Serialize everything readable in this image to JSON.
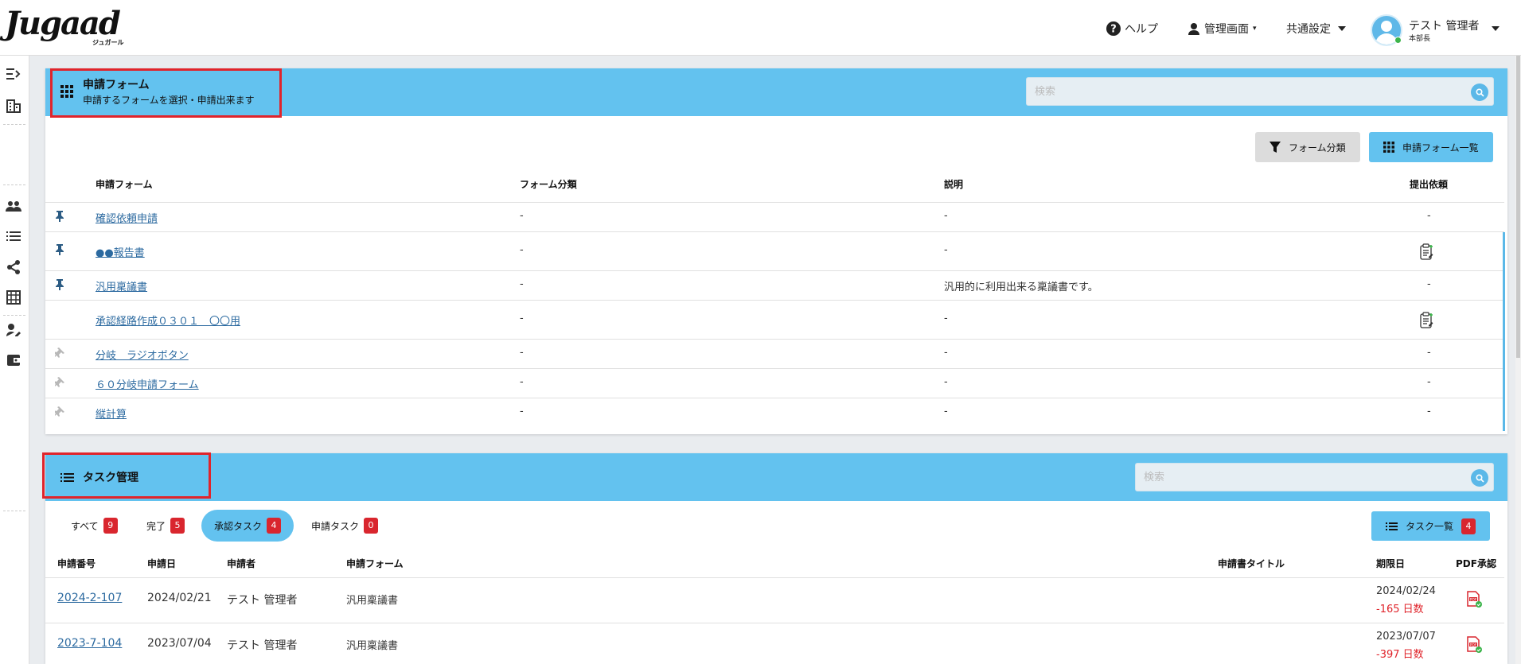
{
  "header": {
    "logo_text": "Jugaad",
    "logo_sub": "ジュガール",
    "help_label": "ヘルプ",
    "admin_label": "管理画面",
    "common_settings_label": "共通設定",
    "user_name": "テスト 管理者",
    "user_role": "本部長"
  },
  "sidebar": {
    "icons": [
      "collapse-icon",
      "building-icon",
      "users-icon",
      "list-icon",
      "share-icon",
      "table-icon",
      "person-edit-icon",
      "wallet-icon"
    ]
  },
  "form_panel": {
    "title": "申請フォーム",
    "subtitle": "申請するフォームを選択・申請出来ます",
    "search_placeholder": "検索",
    "filter_button": "フォーム分類",
    "list_button": "申請フォーム一覧",
    "columns": [
      "申請フォーム",
      "フォーム分類",
      "説明",
      "提出依頼"
    ],
    "rows": [
      {
        "pinned": true,
        "name": "確認依頼申請",
        "category": "-",
        "description": "-",
        "request": "-"
      },
      {
        "pinned": true,
        "name": "●●報告書",
        "category": "-",
        "description": "-",
        "request": "icon"
      },
      {
        "pinned": true,
        "name": "汎用稟議書",
        "category": "-",
        "description": "汎用的に利用出来る稟議書です。",
        "request": "-"
      },
      {
        "pinned": null,
        "name": "承認経路作成０３０１　〇〇用",
        "category": "-",
        "description": "-",
        "request": "icon"
      },
      {
        "pinned": false,
        "name": "分岐　ラジオボタン",
        "category": "-",
        "description": "-",
        "request": "-"
      },
      {
        "pinned": false,
        "name": "６０分岐申請フォーム",
        "category": "-",
        "description": "-",
        "request": "-"
      },
      {
        "pinned": false,
        "name": "縦計算",
        "category": "-",
        "description": "-",
        "request": "-"
      }
    ]
  },
  "task_panel": {
    "title": "タスク管理",
    "search_placeholder": "検索",
    "tabs": [
      {
        "label": "すべて",
        "count": "9"
      },
      {
        "label": "完了",
        "count": "5"
      },
      {
        "label": "承認タスク",
        "count": "4"
      },
      {
        "label": "申請タスク",
        "count": "0"
      }
    ],
    "list_button": "タスク一覧",
    "list_count": "4",
    "columns": [
      "申請番号",
      "申請日",
      "申請者",
      "申請フォーム",
      "申請書タイトル",
      "期限日",
      "PDF承認"
    ],
    "rows": [
      {
        "number": "2024-2-107",
        "date": "2024/02/21",
        "applicant": "テスト 管理者",
        "form": "汎用稟議書",
        "title": "",
        "due": "2024/02/24",
        "days": "-165 日数"
      },
      {
        "number": "2023-7-104",
        "date": "2023/07/04",
        "applicant": "テスト 管理者",
        "form": "汎用稟議書",
        "title": "",
        "due": "2023/07/07",
        "days": "-397 日数"
      }
    ]
  },
  "colors": {
    "panel_head": "#63c2ef",
    "badge": "#d9262e",
    "highlight_box": "#e0242b",
    "link": "#2c6aa0"
  }
}
